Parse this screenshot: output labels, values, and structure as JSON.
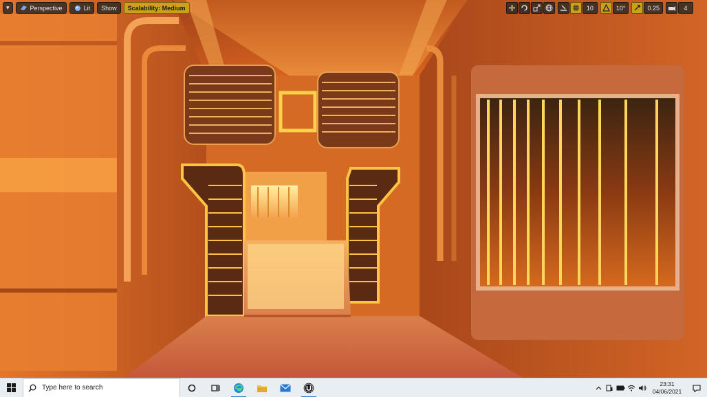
{
  "viewport_toolbar": {
    "menu_label": "▾",
    "perspective_label": "Perspective",
    "lit_label": "Lit",
    "show_label": "Show",
    "scalability_label": "Scalability: Medium",
    "grid_snap_value": "10",
    "rotation_snap_value": "10°",
    "scale_snap_value": "0.25",
    "camera_speed_value": "4"
  },
  "taskbar": {
    "search_placeholder": "Type here to search",
    "time": "23:31",
    "date": "04/06/2021"
  },
  "colors": {
    "scalability_accent": "#c9a21a",
    "taskbar_bg": "#e9eef3"
  }
}
